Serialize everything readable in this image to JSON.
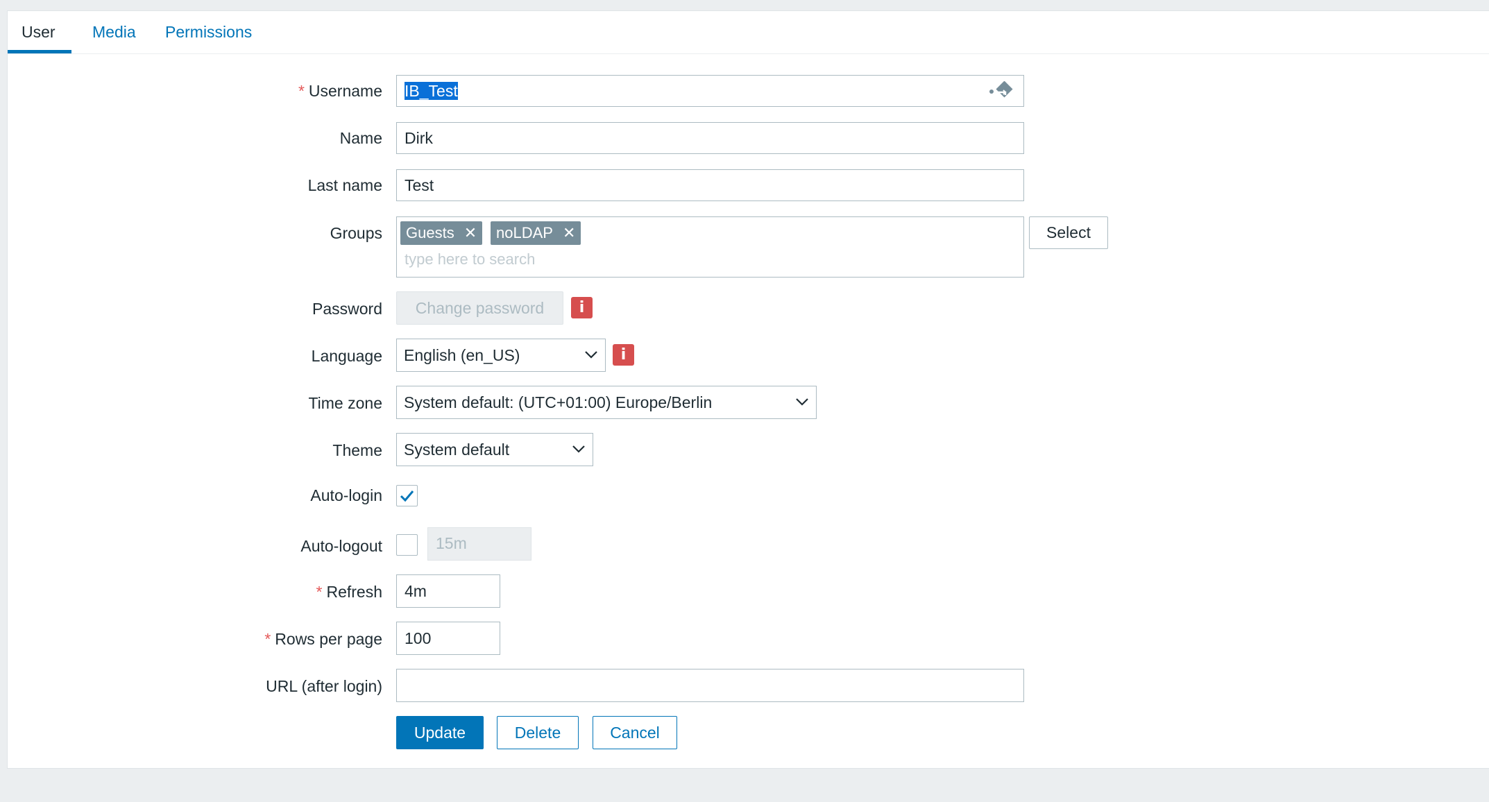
{
  "tabs": [
    {
      "label": "User"
    },
    {
      "label": "Media"
    },
    {
      "label": "Permissions"
    }
  ],
  "form": {
    "required_mark": "*",
    "username": {
      "label": "Username",
      "value": "IB_Test"
    },
    "name": {
      "label": "Name",
      "value": "Dirk"
    },
    "last_name": {
      "label": "Last name",
      "value": "Test"
    },
    "groups": {
      "label": "Groups",
      "tags": [
        "Guests",
        "noLDAP"
      ],
      "tag_remove": "✕",
      "placeholder": "type here to search",
      "select_label": "Select"
    },
    "password": {
      "label": "Password",
      "button": "Change password",
      "info": "i"
    },
    "language": {
      "label": "Language",
      "value": "English (en_US)",
      "info": "i"
    },
    "time_zone": {
      "label": "Time zone",
      "value": "System default: (UTC+01:00) Europe/Berlin"
    },
    "theme": {
      "label": "Theme",
      "value": "System default"
    },
    "auto_login": {
      "label": "Auto-login",
      "checked": true
    },
    "auto_logout": {
      "label": "Auto-logout",
      "checked": false,
      "value": "15m"
    },
    "refresh": {
      "label": "Refresh",
      "value": "4m"
    },
    "rows_per_page": {
      "label": "Rows per page",
      "value": "100"
    },
    "url_after_login": {
      "label": "URL (after login)",
      "value": ""
    }
  },
  "actions": {
    "update": "Update",
    "delete": "Delete",
    "cancel": "Cancel"
  },
  "colors": {
    "accent": "#0275b8",
    "required": "#e45959",
    "info": "#d64e4e",
    "tag": "#768d99",
    "background": "#ebeef0"
  }
}
